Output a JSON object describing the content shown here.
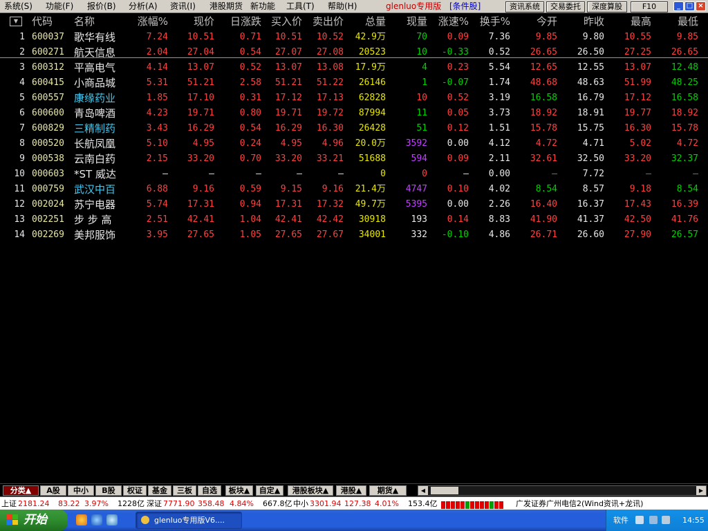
{
  "menu": {
    "items": [
      "系统(S)",
      "功能(F)",
      "报价(B)",
      "分析(A)",
      "资讯(I)",
      "港股期货",
      "新功能",
      "工具(T)",
      "帮助(H)"
    ],
    "title_plain": "glenluo专用版",
    "title_bracket": "[条件股]",
    "buttons": [
      "资讯系统",
      "交易委托",
      "深度算股",
      "F10"
    ]
  },
  "table": {
    "columns": [
      "代码",
      "名称",
      "涨幅%",
      "现价",
      "日涨跌",
      "买入价",
      "卖出价",
      "总量",
      "现量",
      "涨速%",
      "换手%",
      "今开",
      "昨收",
      "最高",
      "最低"
    ],
    "rows": [
      {
        "idx": "1",
        "code": "600037",
        "name": "歌华有线",
        "name_color": "#e8e8e8",
        "chg_pct": "7.24",
        "price": "10.51",
        "chg": "0.71",
        "bid": "10.51",
        "ask": "10.52",
        "vol": "42.9万",
        "cur": "70",
        "cur_color": "#00d000",
        "speed": "0.09",
        "turn": "7.36",
        "open": "9.85",
        "open_color": "#ff4040",
        "prev": "9.80",
        "high": "10.55",
        "high_color": "#ff4040",
        "low": "9.85",
        "low_color": "#ff4040",
        "speed_color": "#ff4040"
      },
      {
        "idx": "2",
        "code": "600271",
        "name": "航天信息",
        "name_color": "#e8e8e8",
        "chg_pct": "2.04",
        "price": "27.04",
        "chg": "0.54",
        "bid": "27.07",
        "ask": "27.08",
        "vol": "20523",
        "cur": "10",
        "cur_color": "#00d000",
        "speed": "-0.33",
        "turn": "0.52",
        "open": "26.65",
        "open_color": "#ff4040",
        "prev": "26.50",
        "high": "27.25",
        "high_color": "#ff4040",
        "low": "26.65",
        "low_color": "#ff4040",
        "speed_color": "#00d000"
      },
      {
        "idx": "3",
        "code": "600312",
        "name": "平高电气",
        "name_color": "#e8e8e8",
        "chg_pct": "4.14",
        "price": "13.07",
        "chg": "0.52",
        "bid": "13.07",
        "ask": "13.08",
        "vol": "17.9万",
        "cur": "4",
        "cur_color": "#00d000",
        "speed": "0.23",
        "turn": "5.54",
        "open": "12.65",
        "open_color": "#ff4040",
        "prev": "12.55",
        "high": "13.07",
        "high_color": "#ff4040",
        "low": "12.48",
        "low_color": "#00d000",
        "speed_color": "#ff4040"
      },
      {
        "idx": "4",
        "code": "600415",
        "name": "小商品城",
        "name_color": "#e8e8e8",
        "chg_pct": "5.31",
        "price": "51.21",
        "chg": "2.58",
        "bid": "51.21",
        "ask": "51.22",
        "vol": "26146",
        "cur": "1",
        "cur_color": "#00d000",
        "speed": "-0.07",
        "turn": "1.74",
        "open": "48.68",
        "open_color": "#ff4040",
        "prev": "48.63",
        "high": "51.99",
        "high_color": "#ff4040",
        "low": "48.25",
        "low_color": "#00d000",
        "speed_color": "#00d000"
      },
      {
        "idx": "5",
        "code": "600557",
        "name": "康缘药业",
        "name_color": "#40c8f0",
        "chg_pct": "1.85",
        "price": "17.10",
        "chg": "0.31",
        "bid": "17.12",
        "ask": "17.13",
        "vol": "62828",
        "cur": "10",
        "cur_color": "#ff4040",
        "speed": "0.52",
        "turn": "3.19",
        "open": "16.58",
        "open_color": "#00d000",
        "prev": "16.79",
        "high": "17.12",
        "high_color": "#ff4040",
        "low": "16.58",
        "low_color": "#00d000",
        "speed_color": "#ff4040"
      },
      {
        "idx": "6",
        "code": "600600",
        "name": "青岛啤酒",
        "name_color": "#e8e8e8",
        "chg_pct": "4.23",
        "price": "19.71",
        "chg": "0.80",
        "bid": "19.71",
        "ask": "19.72",
        "vol": "87994",
        "cur": "11",
        "cur_color": "#00d000",
        "speed": "0.05",
        "turn": "3.73",
        "open": "18.92",
        "open_color": "#ff4040",
        "prev": "18.91",
        "high": "19.77",
        "high_color": "#ff4040",
        "low": "18.92",
        "low_color": "#ff4040",
        "speed_color": "#ff4040"
      },
      {
        "idx": "7",
        "code": "600829",
        "name": "三精制药",
        "name_color": "#40c8f0",
        "chg_pct": "3.43",
        "price": "16.29",
        "chg": "0.54",
        "bid": "16.29",
        "ask": "16.30",
        "vol": "26428",
        "cur": "51",
        "cur_color": "#00d000",
        "speed": "0.12",
        "turn": "1.51",
        "open": "15.78",
        "open_color": "#ff4040",
        "prev": "15.75",
        "high": "16.30",
        "high_color": "#ff4040",
        "low": "15.78",
        "low_color": "#ff4040",
        "speed_color": "#ff4040"
      },
      {
        "idx": "8",
        "code": "000520",
        "name": "长航凤凰",
        "name_color": "#e8e8e8",
        "chg_pct": "5.10",
        "price": "4.95",
        "chg": "0.24",
        "bid": "4.95",
        "ask": "4.96",
        "vol": "20.0万",
        "cur": "3592",
        "cur_color": "#c040ff",
        "speed": "0.00",
        "turn": "4.12",
        "open": "4.72",
        "open_color": "#ff4040",
        "prev": "4.71",
        "high": "5.02",
        "high_color": "#ff4040",
        "low": "4.72",
        "low_color": "#ff4040",
        "speed_color": "#e8e8e8"
      },
      {
        "idx": "9",
        "code": "000538",
        "name": "云南白药",
        "name_color": "#e8e8e8",
        "chg_pct": "2.15",
        "price": "33.20",
        "chg": "0.70",
        "bid": "33.20",
        "ask": "33.21",
        "vol": "51688",
        "cur": "594",
        "cur_color": "#c040ff",
        "speed": "0.09",
        "turn": "2.11",
        "open": "32.61",
        "open_color": "#ff4040",
        "prev": "32.50",
        "high": "33.20",
        "high_color": "#ff4040",
        "low": "32.37",
        "low_color": "#00d000",
        "speed_color": "#ff4040"
      },
      {
        "idx": "10",
        "code": "000603",
        "name": "*ST 威达",
        "name_color": "#e8e8e8",
        "chg_pct": "—",
        "price": "—",
        "chg": "—",
        "bid": "—",
        "ask": "—",
        "vol": "0",
        "cur": "0",
        "cur_color": "#ff4040",
        "speed": "—",
        "turn": "0.00",
        "open": "—",
        "open_color": "#00d000",
        "prev": "7.72",
        "high": "—",
        "high_color": "#00d000",
        "low": "—",
        "low_color": "#00d000",
        "speed_color": "#e8e8e8",
        "dash": true
      },
      {
        "idx": "11",
        "code": "000759",
        "name": "武汉中百",
        "name_color": "#40c8f0",
        "chg_pct": "6.88",
        "price": "9.16",
        "chg": "0.59",
        "bid": "9.15",
        "ask": "9.16",
        "vol": "21.4万",
        "cur": "4747",
        "cur_color": "#c040ff",
        "speed": "0.10",
        "turn": "4.02",
        "open": "8.54",
        "open_color": "#00d000",
        "prev": "8.57",
        "high": "9.18",
        "high_color": "#ff4040",
        "low": "8.54",
        "low_color": "#00d000",
        "speed_color": "#ff4040"
      },
      {
        "idx": "12",
        "code": "002024",
        "name": "苏宁电器",
        "name_color": "#e8e8e8",
        "chg_pct": "5.74",
        "price": "17.31",
        "chg": "0.94",
        "bid": "17.31",
        "ask": "17.32",
        "vol": "49.7万",
        "cur": "5395",
        "cur_color": "#c040ff",
        "speed": "0.00",
        "turn": "2.26",
        "open": "16.40",
        "open_color": "#ff4040",
        "prev": "16.37",
        "high": "17.43",
        "high_color": "#ff4040",
        "low": "16.39",
        "low_color": "#ff4040",
        "speed_color": "#e8e8e8"
      },
      {
        "idx": "13",
        "code": "002251",
        "name": "步 步 高",
        "name_color": "#e8e8e8",
        "chg_pct": "2.51",
        "price": "42.41",
        "chg": "1.04",
        "bid": "42.41",
        "ask": "42.42",
        "vol": "30918",
        "cur": "193",
        "cur_color": "#e8e8e8",
        "speed": "0.14",
        "turn": "8.83",
        "open": "41.90",
        "open_color": "#ff4040",
        "prev": "41.37",
        "high": "42.50",
        "high_color": "#ff4040",
        "low": "41.76",
        "low_color": "#ff4040",
        "speed_color": "#ff4040"
      },
      {
        "idx": "14",
        "code": "002269",
        "name": "美邦服饰",
        "name_color": "#e8e8e8",
        "chg_pct": "3.95",
        "price": "27.65",
        "chg": "1.05",
        "bid": "27.65",
        "ask": "27.67",
        "vol": "34001",
        "cur": "332",
        "cur_color": "#e8e8e8",
        "speed": "-0.10",
        "turn": "4.86",
        "open": "26.71",
        "open_color": "#ff4040",
        "prev": "26.60",
        "high": "27.90",
        "high_color": "#ff4040",
        "low": "26.57",
        "low_color": "#00d000",
        "speed_color": "#00d000"
      }
    ]
  },
  "tabs": [
    {
      "label": "分类▲",
      "active": true
    },
    {
      "label": "A股",
      "active": false
    },
    {
      "label": "中小",
      "active": false
    },
    {
      "label": "B股",
      "active": false
    },
    {
      "label": "权证",
      "active": false
    },
    {
      "label": "基金",
      "active": false
    },
    {
      "label": "三板",
      "active": false
    },
    {
      "label": "自选",
      "active": false
    },
    {
      "label": "板块▲",
      "active": false
    },
    {
      "label": "自定▲",
      "active": false
    },
    {
      "label": "港股板块▲",
      "active": false
    },
    {
      "label": "港股▲",
      "active": false
    },
    {
      "label": "期货▲",
      "active": false
    }
  ],
  "status": {
    "sh_label": "上证",
    "sh_val": "2181.24",
    "sh_chg": "83.22",
    "sh_pct": "3.97%",
    "sh_amt": "1228亿",
    "sz_label": "深证",
    "sz_val": "7771.90",
    "sz_chg": "358.48",
    "sz_pct": "4.84%",
    "sz_amt": "667.8亿",
    "zx_label": "中小",
    "zx_val": "3301.94",
    "zx_chg": "127.38",
    "zx_pct": "4.01%",
    "zx_amt": "153.4亿",
    "broker": "广发证券广州电信2(Wind资讯+龙讯)"
  },
  "taskbar": {
    "start": "开始",
    "task": "glenluo专用版V6....",
    "tray_text": "软件",
    "clock": "14:55"
  },
  "colors": {
    "up": "#ff4040",
    "down": "#00d000",
    "code": "#e8e8a0",
    "index": "#e8e8e8",
    "vol": "#e8e800",
    "neutral": "#e8e8e8"
  }
}
